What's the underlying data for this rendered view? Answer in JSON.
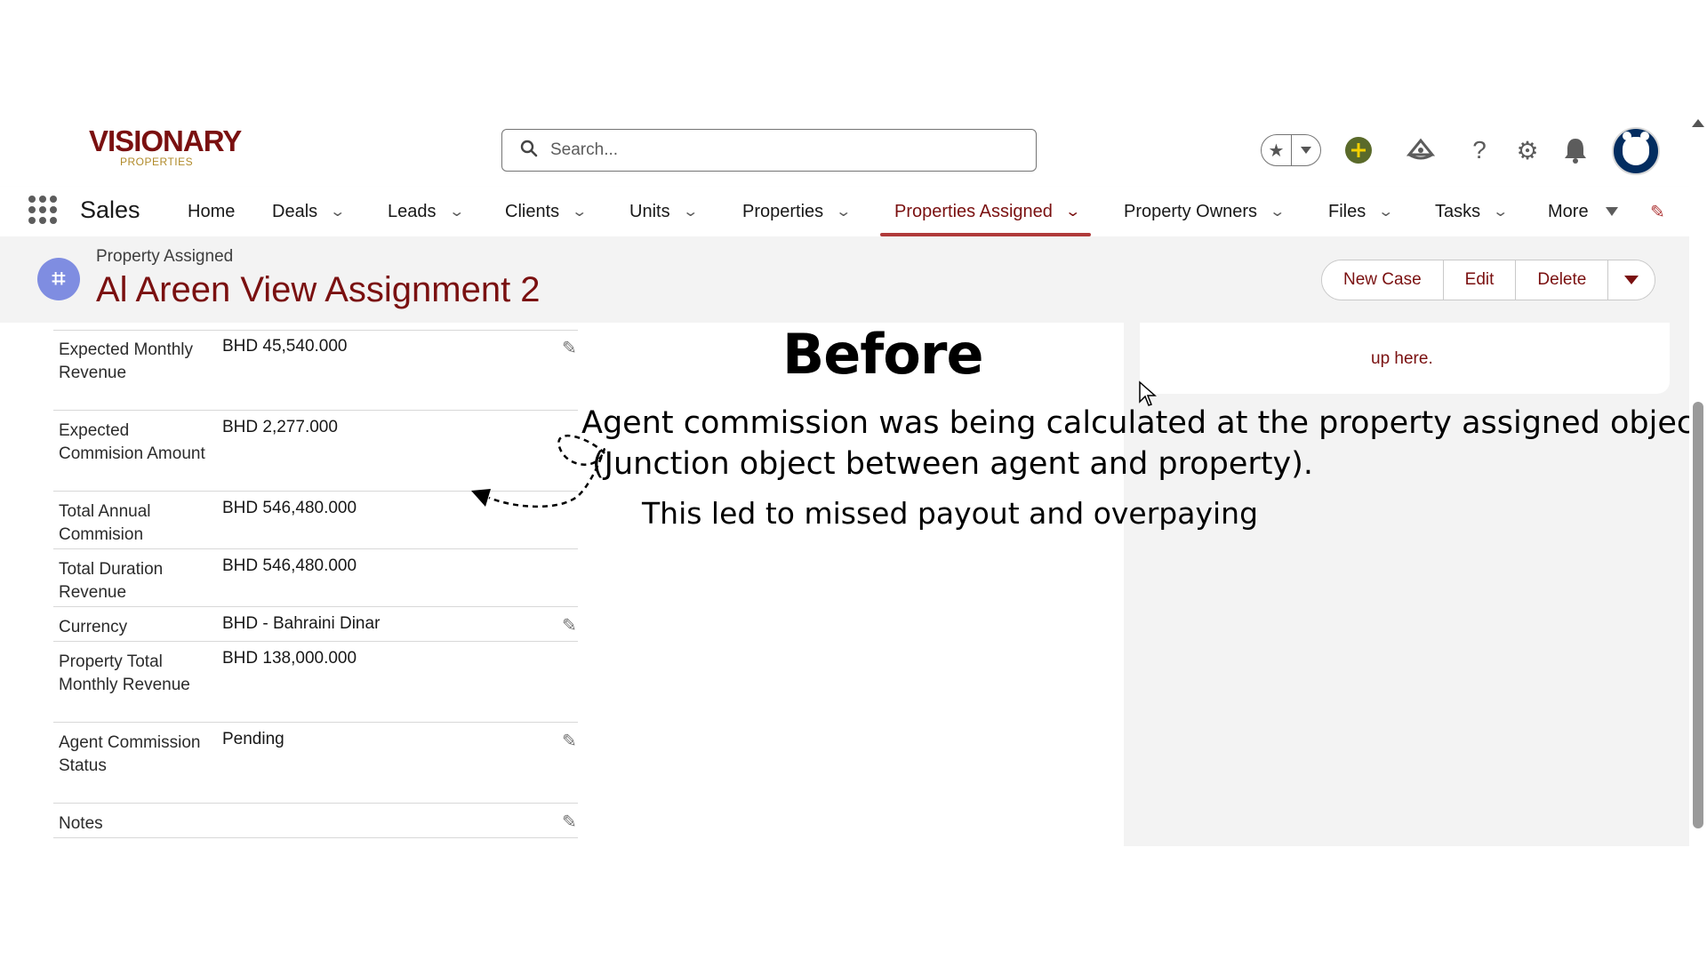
{
  "header": {
    "logo_text": "VISIONARY",
    "logo_sub": "PROPERTIES",
    "search_placeholder": "Search..."
  },
  "nav": {
    "app_name": "Sales",
    "items": [
      {
        "label": "Home"
      },
      {
        "label": "Deals"
      },
      {
        "label": "Leads"
      },
      {
        "label": "Clients"
      },
      {
        "label": "Units"
      },
      {
        "label": "Properties"
      },
      {
        "label": "Properties Assigned"
      },
      {
        "label": "Property Owners"
      },
      {
        "label": "Files"
      },
      {
        "label": "Tasks"
      },
      {
        "label": "More"
      }
    ]
  },
  "record": {
    "type": "Property Assigned",
    "title": "Al Areen View Assignment 2",
    "actions": {
      "new_case": "New Case",
      "edit": "Edit",
      "delete": "Delete"
    }
  },
  "fields": [
    {
      "label": "Expected Monthly Revenue",
      "value": "BHD 45,540.000"
    },
    {
      "label": "Expected Commision Amount",
      "value": "BHD 2,277.000"
    },
    {
      "label": "Total Annual Commision",
      "value": "BHD 546,480.000"
    },
    {
      "label": "Total Duration Revenue",
      "value": "BHD 546,480.000"
    },
    {
      "label": "Currency",
      "value": "BHD - Bahraini Dinar"
    },
    {
      "label": "Property Total Monthly Revenue",
      "value": "BHD 138,000.000"
    },
    {
      "label": "Agent Commission Status",
      "value": "Pending"
    },
    {
      "label": "Notes",
      "value": ""
    }
  ],
  "right_panel": {
    "text": "up here."
  },
  "annotation": {
    "title": "Before",
    "line1": "Agent commission was being calculated at the property assigned object",
    "line2": "(Junction object between agent and property).",
    "line3": "This led to missed payout and overpaying"
  },
  "colors": {
    "brand": "#7a1010",
    "accent_underline": "#b03a3a",
    "record_icon": "#7f8de1",
    "avatar": "#032d60"
  }
}
